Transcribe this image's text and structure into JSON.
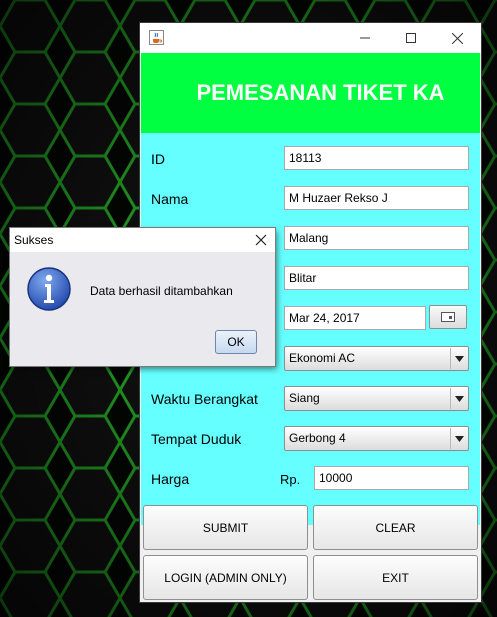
{
  "window": {
    "icon": "java-cup-icon",
    "controls": [
      "minimize-icon",
      "maximize-icon",
      "close-icon"
    ]
  },
  "header": {
    "title": "PEMESANAN TIKET KA",
    "bg_color": "#00ff40"
  },
  "form": {
    "bg_color": "#66ffff",
    "fields": {
      "id": {
        "label": "ID",
        "value": "18113"
      },
      "nama": {
        "label": "Nama",
        "value": "M Huzaer Rekso J"
      },
      "asal": {
        "value": "Malang"
      },
      "tujuan": {
        "value": "Blitar"
      },
      "tanggal": {
        "value": "Mar 24, 2017",
        "icon": "calendar-icon"
      },
      "kelas": {
        "value": "Ekonomi AC"
      },
      "waktu": {
        "label": "Waktu Berangkat",
        "value": "Siang"
      },
      "tempat": {
        "label": "Tempat Duduk",
        "value": "Gerbong 4"
      },
      "harga": {
        "label": "Harga",
        "prefix": "Rp.",
        "value": "10000"
      }
    }
  },
  "buttons": {
    "submit": "SUBMIT",
    "clear": "CLEAR",
    "login": "LOGIN (ADMIN ONLY)",
    "exit": "EXIT"
  },
  "dialog": {
    "title": "Sukses",
    "message": "Data berhasil ditambahkan",
    "ok": "OK",
    "icon": "info-icon"
  }
}
